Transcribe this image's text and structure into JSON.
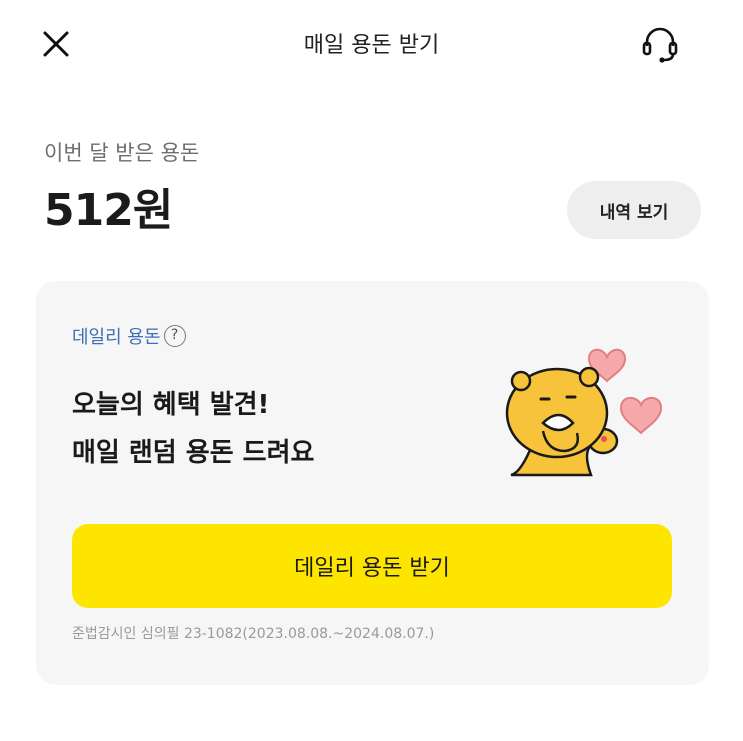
{
  "header": {
    "title": "매일 용돈 받기",
    "close_icon": "close-icon",
    "support_icon": "headset-icon"
  },
  "summary": {
    "label": "이번 달 받은 용돈",
    "amount": "512원",
    "history_button": "내역 보기"
  },
  "card": {
    "tag": "데일리 용돈",
    "help_glyph": "?",
    "headline_line1": "오늘의 혜택 발견!",
    "headline_line2": "매일 랜덤 용돈 드려요",
    "mascot_icon": "lion-mascot-with-hearts",
    "cta_button": "데일리 용돈 받기",
    "legal_text": "준법감시인 심의필 23-1082(2023.08.08.~2024.08.07.)"
  },
  "colors": {
    "accent_yellow": "#fde500",
    "tag_blue": "#3d6fb5",
    "card_bg": "#f6f6f7",
    "heart_pink": "#f6a9ab"
  }
}
